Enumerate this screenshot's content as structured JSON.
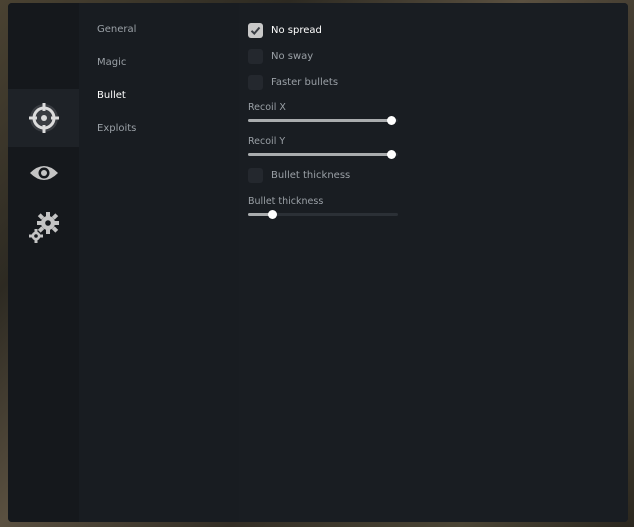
{
  "rail": [
    {
      "name": "crosshair-icon",
      "active": true
    },
    {
      "name": "eye-icon",
      "active": false
    },
    {
      "name": "gears-icon",
      "active": false
    }
  ],
  "categories": {
    "general": "General",
    "magic": "Magic",
    "bullet": "Bullet",
    "exploits": "Exploits",
    "active": "Bullet"
  },
  "options": {
    "no_spread": {
      "label": "No spread",
      "checked": true
    },
    "no_sway": {
      "label": "No sway",
      "checked": false
    },
    "faster_bullets": {
      "label": "Faster bullets",
      "checked": false
    },
    "bullet_thickness_toggle": {
      "label": "Bullet thickness",
      "checked": false
    }
  },
  "sliders": {
    "recoil_x": {
      "label": "Recoil X",
      "value": 0.95
    },
    "recoil_y": {
      "label": "Recoil Y",
      "value": 0.95
    },
    "bullet_thickness": {
      "label": "Bullet thickness",
      "value": 0.16
    }
  },
  "colors": {
    "accent": "#c8c8c8",
    "panel": "#171b20",
    "text_muted": "#9aa0a6"
  }
}
